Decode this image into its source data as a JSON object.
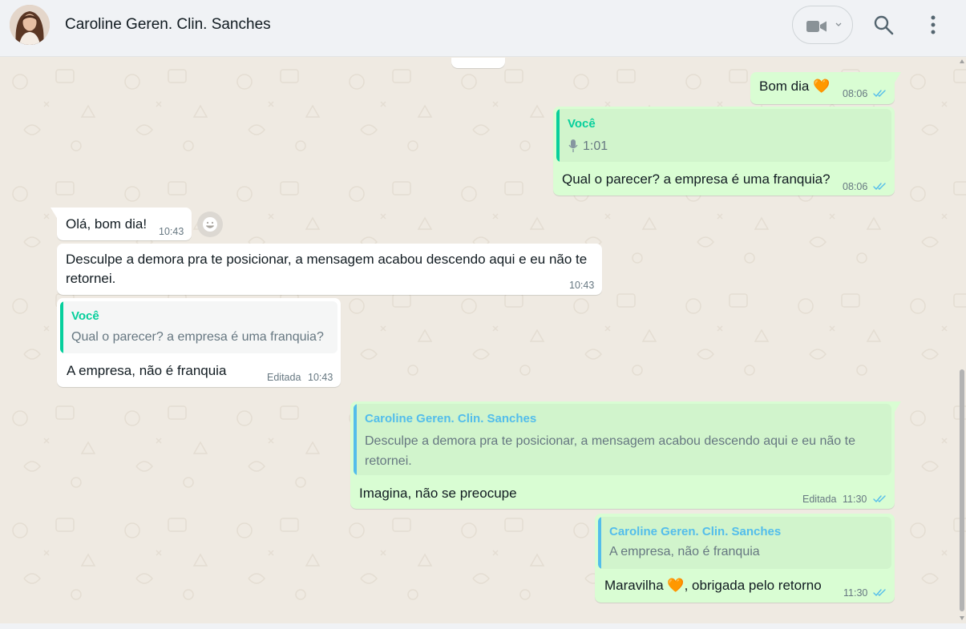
{
  "header": {
    "contact_name": "Caroline Geren. Clin. Sanches"
  },
  "icons": {
    "video": "video-camera-icon",
    "search": "search-icon",
    "menu": "more-vertical-icon"
  },
  "colors": {
    "outgoing_bubble": "#d9fdd3",
    "incoming_bubble": "#ffffff",
    "read_ticks": "#53bdeb",
    "quote_self_author": "#06cf9c",
    "quote_contact_author": "#53bdeb",
    "chat_background": "#efeae2"
  },
  "messages": [
    {
      "id": "m1",
      "direction": "outgoing",
      "text": "Bom dia 🧡",
      "time": "08:06",
      "status": "read"
    },
    {
      "id": "m2",
      "direction": "outgoing",
      "quote": {
        "author": "Você",
        "text": "1:01",
        "type": "voice-note"
      },
      "text": "Qual o parecer? a empresa é uma franquia?",
      "time": "08:06",
      "status": "read"
    },
    {
      "id": "m3",
      "direction": "incoming",
      "text": "Olá, bom dia!",
      "time": "10:43"
    },
    {
      "id": "m4",
      "direction": "incoming",
      "text": "Desculpe a demora pra te posicionar, a mensagem acabou descendo aqui e eu não te retornei.",
      "time": "10:43"
    },
    {
      "id": "m5",
      "direction": "incoming",
      "quote": {
        "author": "Você",
        "text": "Qual o parecer? a empresa é uma franquia?"
      },
      "text": "A empresa, não é franquia",
      "edited": "Editada",
      "time": "10:43"
    },
    {
      "id": "m6",
      "direction": "outgoing",
      "quote": {
        "author": "Caroline Geren. Clin. Sanches",
        "text": "Desculpe a demora pra te posicionar, a mensagem acabou descendo aqui e eu não te retornei."
      },
      "text": "Imagina, não se preocupe",
      "edited": "Editada",
      "time": "11:30",
      "status": "read"
    },
    {
      "id": "m7",
      "direction": "outgoing",
      "quote": {
        "author": "Caroline Geren. Clin. Sanches",
        "text": "A empresa, não é franquia"
      },
      "text": "Maravilha 🧡, obrigada pelo retorno",
      "time": "11:30",
      "status": "read"
    }
  ]
}
